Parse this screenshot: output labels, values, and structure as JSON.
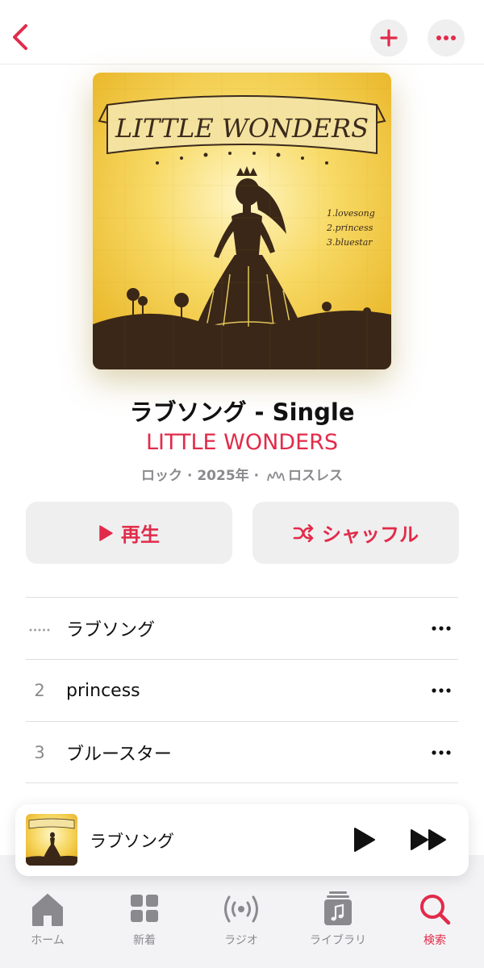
{
  "album": {
    "title": "ラブソング - Single",
    "artist": "LITTLE WONDERS",
    "meta_genre_year": "ロック · 2025年 · ",
    "meta_quality": "ロスレス",
    "cover": {
      "banner_text": "LITTLE WONDERS",
      "tracklist": [
        "1.lovesong",
        "2.princess",
        "3.bluestar"
      ]
    }
  },
  "actions": {
    "play_label": "再生",
    "shuffle_label": "シャッフル"
  },
  "tracks": [
    {
      "number": "",
      "title": "ラブソング",
      "now_playing": true
    },
    {
      "number": "2",
      "title": "princess",
      "now_playing": false
    },
    {
      "number": "3",
      "title": "ブルースター",
      "now_playing": false
    }
  ],
  "mini_player": {
    "title": "ラブソング"
  },
  "tabs": [
    {
      "label": "ホーム",
      "icon": "home-icon",
      "active": false
    },
    {
      "label": "新着",
      "icon": "grid-icon",
      "active": false
    },
    {
      "label": "ラジオ",
      "icon": "radio-icon",
      "active": false
    },
    {
      "label": "ライブラリ",
      "icon": "library-icon",
      "active": false
    },
    {
      "label": "検索",
      "icon": "search-icon",
      "active": true
    }
  ],
  "colors": {
    "accent": "#e22b4a",
    "secondary_text": "#8a8a8e",
    "button_bg": "#efeff0"
  }
}
